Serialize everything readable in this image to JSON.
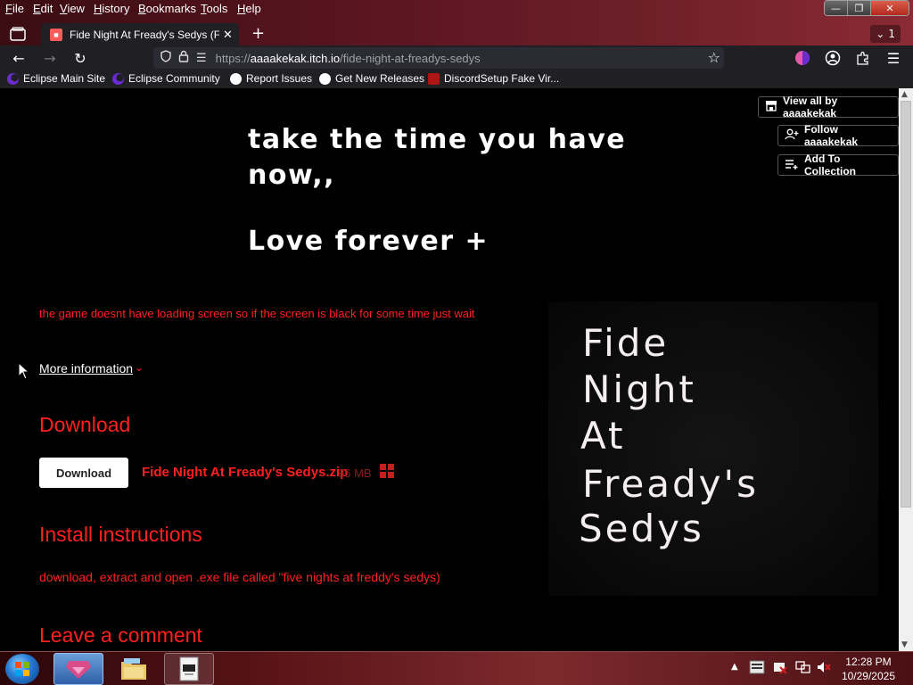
{
  "menubar": {
    "items": [
      "File",
      "Edit",
      "View",
      "History",
      "Bookmarks",
      "Tools",
      "Help"
    ]
  },
  "tabs": {
    "active_title": "Fide Night At Fready's Sedys (FN",
    "overflow_count": "1"
  },
  "navbar": {
    "url_prefix": "https://",
    "url_domain": "aaaakekak.itch.io",
    "url_path": "/fide-night-at-freadys-sedys"
  },
  "bookmarks": [
    {
      "label": "Eclipse Main Site",
      "icon": "eclipse-icon"
    },
    {
      "label": "Eclipse Community",
      "icon": "eclipse-icon"
    },
    {
      "label": "Report Issues",
      "icon": "github-icon"
    },
    {
      "label": "Get New Releases",
      "icon": "github-icon"
    },
    {
      "label": "DiscordSetup Fake Vir...",
      "icon": "red-app-icon"
    }
  ],
  "header_image": {
    "line1": "take the time you have",
    "line2": "now,,",
    "line3": "Love forever +"
  },
  "actions": {
    "view_all": "View all by aaaakekak",
    "follow": "Follow aaaakekak",
    "add_collection": "Add To Collection"
  },
  "page": {
    "notice": "the game doesnt have loading screen so if the screen is black for some time just wait",
    "more_info": "More information",
    "download_heading": "Download",
    "download_button": "Download",
    "file_name": "Fide Night At Fready's Sedys.zip",
    "file_size": "96 MB",
    "install_heading": "Install instructions",
    "install_text": "download, extract and open .exe file called \"five nights at freddy's sedys)",
    "comment_heading": "Leave a comment"
  },
  "cover": {
    "line1": "Fide",
    "line2": "Night",
    "line3": "At",
    "line4": "Fready's",
    "line5": "Sedys"
  },
  "taskbar": {
    "time": "12:28 PM",
    "date": "10/29/2025"
  },
  "colors": {
    "accent_red": "#ff2020",
    "page_bg": "#000000",
    "toolbar_bg": "#1f1f24"
  }
}
